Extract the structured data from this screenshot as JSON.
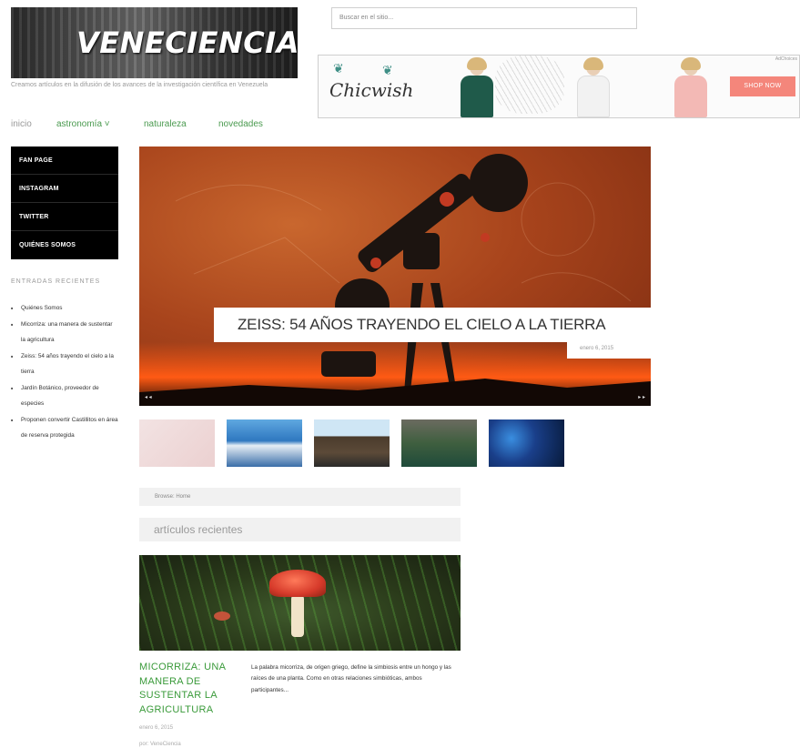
{
  "site": {
    "logo_text": "VENECIENCIA",
    "tagline": "Creamos artículos en la difusión de los avances de la investigación científica en Venezuela"
  },
  "search": {
    "placeholder": "Buscar en el sitio..."
  },
  "ad": {
    "brand": "Chicwish",
    "button": "SHOP NOW",
    "adchoice": "AdChoices"
  },
  "nav": {
    "items": [
      {
        "label": "inicio"
      },
      {
        "label": "astronomía ˅"
      },
      {
        "label": "naturaleza"
      },
      {
        "label": "novedades"
      }
    ]
  },
  "sidebar": {
    "menu": [
      {
        "label": "FAN PAGE"
      },
      {
        "label": "INSTAGRAM"
      },
      {
        "label": "TWITTER"
      },
      {
        "label": "QUIÉNES SOMOS"
      }
    ],
    "recent_title": "ENTRADAS RECIENTES",
    "recent": [
      {
        "label": "Quiénes Somos"
      },
      {
        "label": "Micorriza: una manera de sustentar la agricultura"
      },
      {
        "label": "Zeiss: 54 años trayendo el cielo a la tierra"
      },
      {
        "label": "Jardín Botánico, proveedor de especies"
      },
      {
        "label": "Proponen convertir Castillitos en área de reserva protegida"
      }
    ]
  },
  "slider": {
    "title": "ZEISS: 54 AÑOS TRAYENDO EL CIELO A LA TIERRA",
    "date": "enero 6, 2015",
    "prev": "◂ ◂",
    "next": "▸ ▸"
  },
  "breadcrumb": "Browse: Home",
  "section_title": "artículos recientes",
  "article": {
    "title": "MICORRIZA: UNA MANERA DE SUSTENTAR LA AGRICULTURA",
    "date": "enero 6, 2015",
    "author": "por: VeneCiencia",
    "excerpt": "La palabra micorriza, de origen griego, define la simbiosis entre un hongo y las raíces de una planta. Como en otras relaciones simbióticas, ambos participantes..."
  }
}
